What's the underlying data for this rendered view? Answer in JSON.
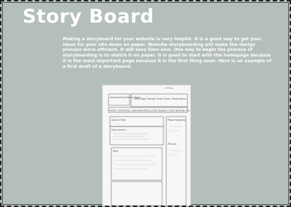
{
  "page": {
    "title": "Story Board",
    "intro": "Making a storyboard for your website is very helpful. It is a good way to get your ideas for your site down on paper. Website storyboarding will make the design process more efficient. It will save time also. One way to begin the process of storyboarding is to sketch it on paper. It is good to start with the homepage because it is the most important page because it is the first thing seen. Here is an example of a first draft of a storyboard:"
  },
  "sketch": {
    "header_left": "Introduction/Home Page",
    "header_right": "Web Page Design Flash Story Illustrations",
    "nav": "Home | Portfolio | Storyboarding | Site Design | Site Testing | Co",
    "article_title": "Article Title",
    "caption": "Description...",
    "text_label": "Text",
    "sidebar_title": "Page Heading",
    "sidebar_item": "Picture"
  }
}
